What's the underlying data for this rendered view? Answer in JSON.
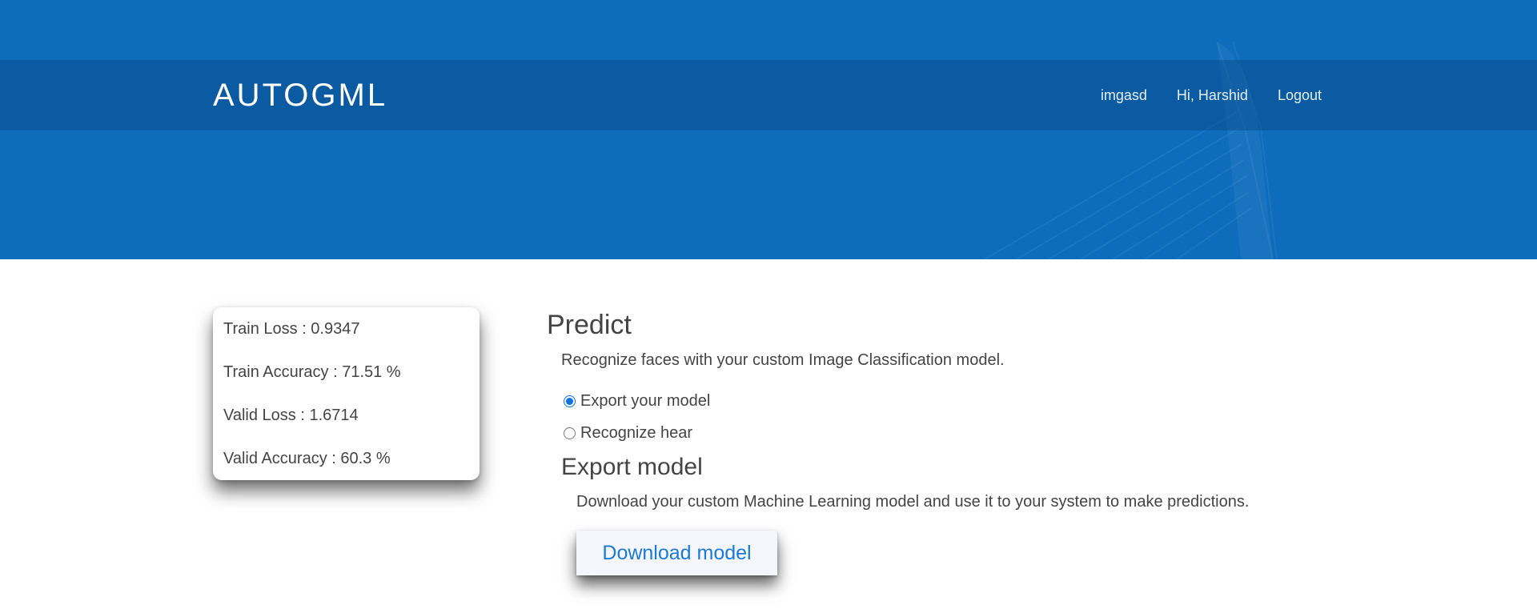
{
  "navbar": {
    "brand": "AUTOGML",
    "links": [
      "imgasd",
      "Hi, Harshid",
      "Logout"
    ]
  },
  "stats": [
    "Train Loss : 0.9347",
    "Train Accuracy : 71.51 %",
    "Valid Loss : 1.6714",
    "Valid Accuracy : 60.3 %"
  ],
  "predict": {
    "title": "Predict",
    "description": "Recognize faces with your custom Image Classification model.",
    "options": [
      {
        "label": "Export your model",
        "checked": true
      },
      {
        "label": "Recognize hear",
        "checked": false
      }
    ]
  },
  "export": {
    "title": "Export model",
    "description": "Download your custom Machine Learning model and use it to your system to make predictions.",
    "button_label": "Download model"
  },
  "colors": {
    "hero": "#0d6cbb",
    "accent": "#1a7ad8"
  }
}
